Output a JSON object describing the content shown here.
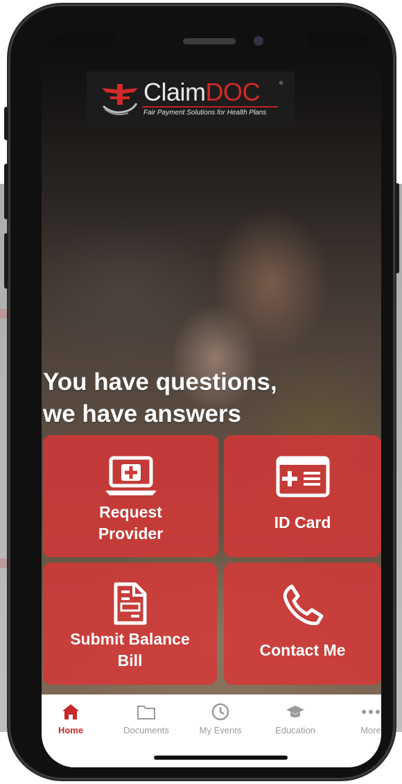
{
  "logo": {
    "brand_plain": "Claim",
    "brand_accent": "DOC",
    "registered": "®",
    "tagline": "Fair Payment Solutions for Health Plans"
  },
  "hero": {
    "headline_line1": "You have questions,",
    "headline_line2": "we have answers"
  },
  "tiles": [
    {
      "label_line1": "Request",
      "label_line2": "Provider",
      "icon": "laptop-plus-icon"
    },
    {
      "label": "ID Card",
      "icon": "id-card-icon"
    },
    {
      "label_line1": "Submit Balance",
      "label_line2": "Bill",
      "icon": "document-icon"
    },
    {
      "label": "Contact Me",
      "icon": "phone-icon"
    }
  ],
  "tabbar": {
    "items": [
      {
        "label": "Home",
        "icon": "home-icon",
        "active": true
      },
      {
        "label": "Documents",
        "icon": "folder-icon"
      },
      {
        "label": "My Events",
        "icon": "clock-icon"
      },
      {
        "label": "Education",
        "icon": "graduation-cap-icon"
      },
      {
        "label": "More",
        "icon": "more-dots-icon"
      }
    ]
  },
  "colors": {
    "accent": "#d22a2a",
    "tile": "#d63737",
    "tab_active": "#c8282a",
    "tab_inactive": "#9a9a9a"
  }
}
